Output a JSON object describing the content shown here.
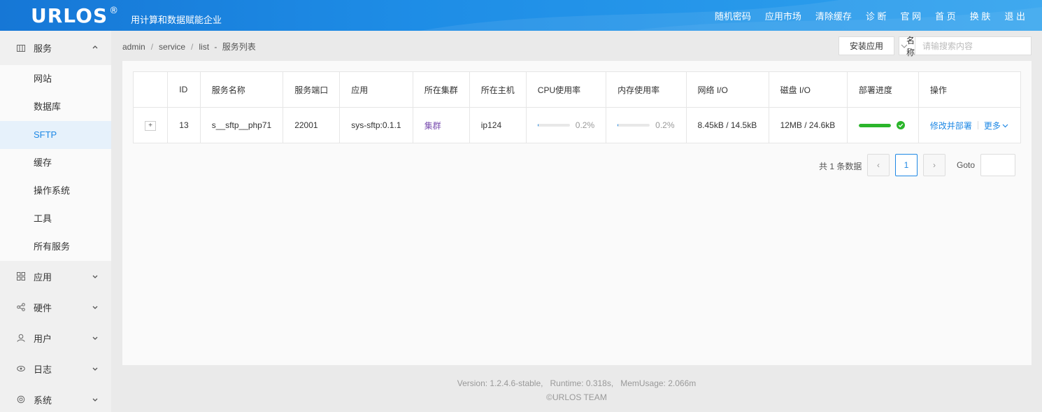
{
  "header": {
    "logo": "URLOS",
    "logo_mark": "®",
    "slogan": "用计算和数据赋能企业",
    "nav": [
      "随机密码",
      "应用市场",
      "清除缓存",
      "诊 断",
      "官 网",
      "首 页",
      "换 肤",
      "退 出"
    ]
  },
  "sidebar": {
    "groups": [
      {
        "label": "服务",
        "icon": "grid-icon",
        "expanded": true
      },
      {
        "label": "应用",
        "icon": "apps-icon"
      },
      {
        "label": "硬件",
        "icon": "share-icon"
      },
      {
        "label": "用户",
        "icon": "user-icon"
      },
      {
        "label": "日志",
        "icon": "eye-icon"
      },
      {
        "label": "系统",
        "icon": "settings-icon"
      }
    ],
    "service_items": [
      "网站",
      "数据库",
      "SFTP",
      "缓存",
      "操作系统",
      "工具",
      "所有服务"
    ],
    "active_item": "SFTP"
  },
  "breadcrumb": {
    "items": [
      "admin",
      "service",
      "list"
    ],
    "dash": "-",
    "page": "服务列表"
  },
  "toolbar": {
    "install_label": "安装应用",
    "search_select": "名称",
    "search_placeholder": "请输搜索内容"
  },
  "table": {
    "headers": [
      "",
      "ID",
      "服务名称",
      "服务端口",
      "应用",
      "所在集群",
      "所在主机",
      "CPU使用率",
      "内存使用率",
      "网络 I/O",
      "磁盘 I/O",
      "部署进度",
      "操作"
    ],
    "rows": [
      {
        "expand": "+",
        "id": "13",
        "name": "s__sftp__php71",
        "port": "22001",
        "app": "sys-sftp:0.1.1",
        "cluster": "集群",
        "host": "ip124",
        "cpu": "0.2%",
        "cpu_value": 0.2,
        "mem": "0.2%",
        "mem_value": 0.2,
        "net": "8.45kB / 14.5kB",
        "disk": "12MB / 24.6kB",
        "deploy_progress": 100,
        "op_edit": "修改并部署",
        "op_more": "更多"
      }
    ]
  },
  "pager": {
    "total": "共 1 条数据",
    "prev": "‹",
    "current": "1",
    "next": "›",
    "goto": "Goto"
  },
  "footer": {
    "line1": "Version: 1.2.4.6-stable,   Runtime: 0.318s,   MemUsage: 2.066m",
    "line2": "©URLOS TEAM"
  },
  "colors": {
    "accent": "#1e88e5",
    "header": "#1e8de6",
    "success": "#2bb52b"
  }
}
